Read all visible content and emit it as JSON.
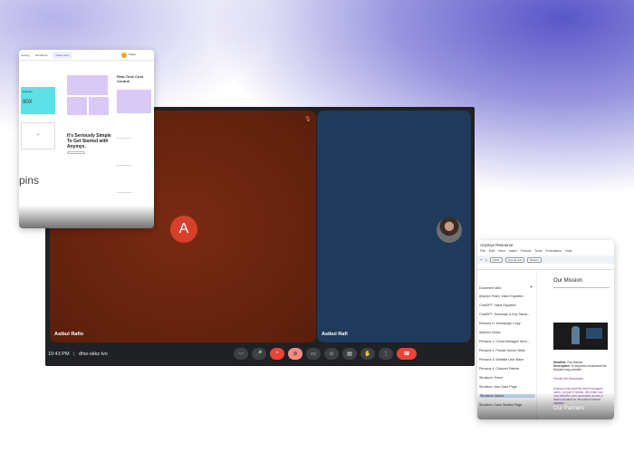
{
  "meet": {
    "left_name": "Asibul Rafio",
    "right_name": "Asibul Rafi",
    "avatar_letter": "A",
    "time": "10:43 PM",
    "separator": "|",
    "meeting_code": "dhw-skkz-lvo",
    "accent_color": "#ea4335"
  },
  "left_panel": {
    "tabs": [
      "Getting",
      "Workflows",
      "Open Canv"
    ],
    "active_tab": "Open Canv",
    "share_label": "Share",
    "heading": "It's Seriously Simple To Get Started with Anymyx.",
    "right_heading": "Real-Time Cost Control",
    "big_text": "pins",
    "cyan_label": "Anymyx",
    "cyan_big": "90X"
  },
  "doc_panel": {
    "title": "Anymyx Resource",
    "menu": [
      "File",
      "Edit",
      "View",
      "Insert",
      "Format",
      "Tools",
      "Extensions",
      "Help"
    ],
    "zoom": "100%",
    "style": "Normal text",
    "font": "Roboto",
    "outline_title": "Document tabs",
    "outline_items": [
      "Anymyx Team: Value Equation",
      "ChatGPT: Value Equation",
      "ChatGPT: Summary & Key Takea...",
      "Revised H: Homepage Copy",
      "Anthium Notes",
      "Persona 1: Cloud Managed Servi...",
      "Persona 2: Private Server Skills",
      "Persona 3: Website User Base",
      "Persona 4: Channel Partner",
      "Structure: Home",
      "Structure: Use Case Page",
      "Structure: About",
      "Structure: Case Studies Page"
    ],
    "selected_item": "Structure: About",
    "h1": "Our Mission",
    "headline_label": "Headline:",
    "headline_text": "Our Mission",
    "desc_label": "Description:",
    "desc_text": "To empower businesses the simplest way possible.",
    "link1": "Flexibit Out Description",
    "link2": "Anymyx puts powerful cloud managem users, not just IT teams. We make clou cost-effective, and accessible across a teams focused on innovation instead updates.",
    "h2": "Our Partners"
  }
}
